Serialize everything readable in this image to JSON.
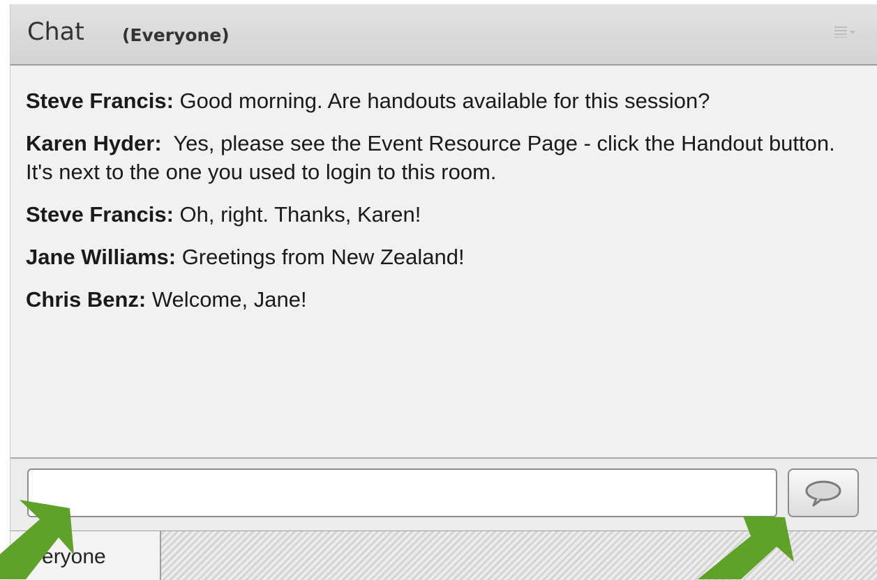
{
  "header": {
    "title": "Chat",
    "scope": "(Everyone)",
    "menu_icon": "panel-menu-icon"
  },
  "messages": [
    {
      "sender": "Steve Francis:",
      "text": " Good morning. Are handouts available for this session?"
    },
    {
      "sender": "Karen Hyder:",
      "text": "  Yes, please see the Event Resource Page - click the Handout button. It's next to the one you used to login to this room."
    },
    {
      "sender": "Steve Francis:",
      "text": " Oh, right. Thanks, Karen!"
    },
    {
      "sender": "Jane Williams:",
      "text": " Greetings from New Zealand!"
    },
    {
      "sender": "Chris Benz:",
      "text": " Welcome, Jane!"
    }
  ],
  "composer": {
    "input_value": "",
    "input_placeholder": "",
    "send_icon": "speech-bubble-icon"
  },
  "tabs": {
    "everyone": "Everyone"
  },
  "colors": {
    "arrow": "#5ea22a",
    "header_bg": "#d9d9d9",
    "panel_bg": "#f1f1f1"
  }
}
